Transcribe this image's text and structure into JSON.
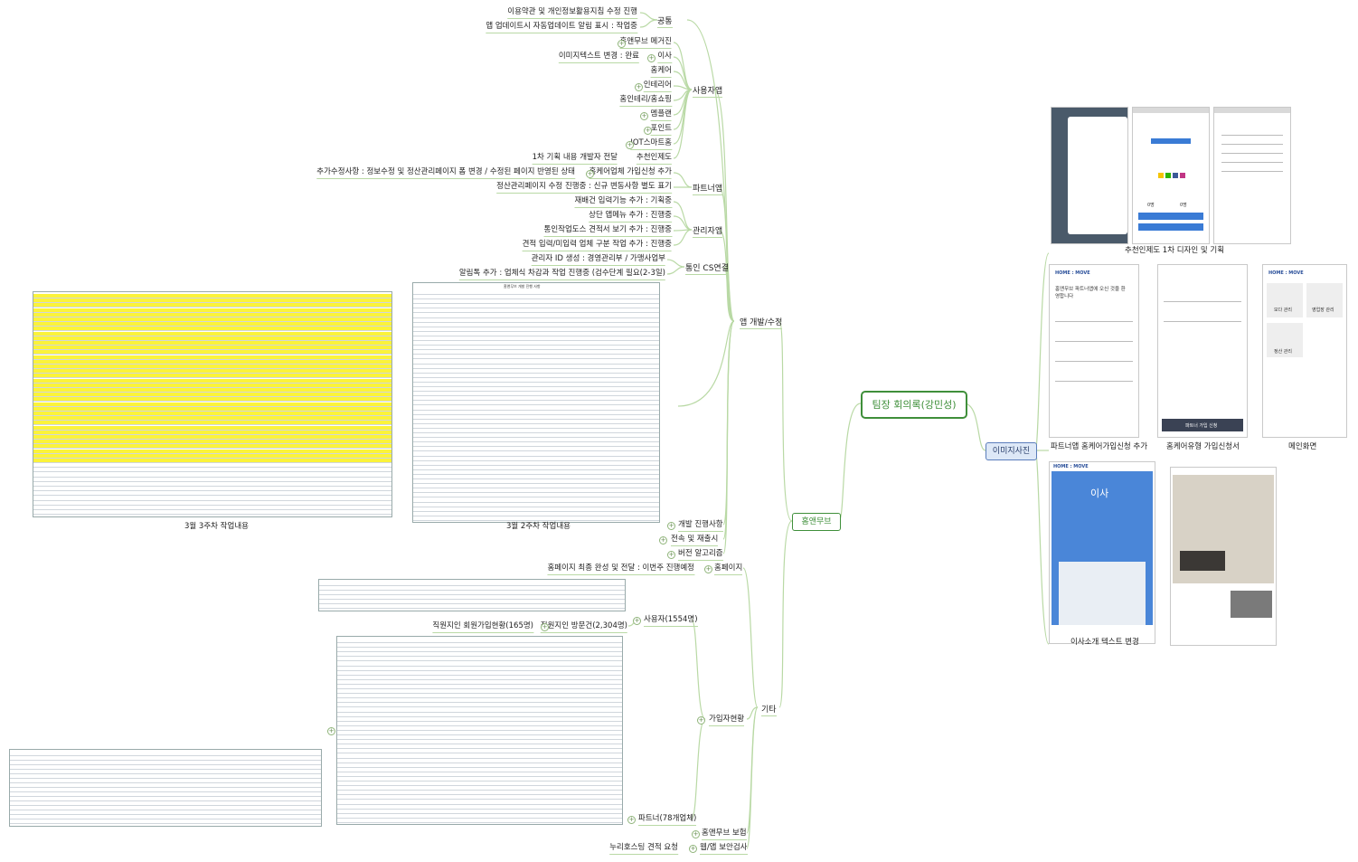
{
  "central": "팀장 회의록(강민성)",
  "left_root": "홈앤무브",
  "right_root": "이미지사진",
  "app_dev": {
    "label": "앱 개발/수정",
    "common": {
      "label": "공통",
      "items": [
        "이용약관 및 개인정보활용지침 수정 진행",
        "앱 업데이트시 자동업데이트 알림 표시 : 작업중"
      ]
    },
    "user_app": {
      "label": "사용자앱",
      "items": [
        "홈앤무브 메거진",
        "이사",
        "이미지텍스트 변경 : 완료",
        "홈케어",
        "인테리어",
        "홈인테리/홈쇼핑",
        "멤플랜",
        "포인트",
        "IOT스마트홈",
        "추천인제도"
      ],
      "recommend_note": "1차 기획 내용 개발자 전달"
    },
    "partner_app": {
      "label": "파트너앱",
      "join": "홈케어업체 가입신청 추가",
      "join_note": "추가수정사항 : 정보수정 및 정산관리페이지 폼 변경 / 수정된 페이지 반영된 상태",
      "settle": "정산관리페이지 수정 진행중 : 신규 변동사항 별도 표기"
    },
    "admin_app": {
      "label": "관리자앱",
      "items": [
        "재배건 입력기능 추가 : 기획중",
        "상단 앱메뉴 추가 : 진행중",
        "통인작업도스 견적서 보기 추가 : 진행중",
        "견적 입력/미입력 업체 구분 작업 추가 : 진행중"
      ]
    },
    "cs": {
      "label": "통인 CS연결",
      "items": [
        "관리자 ID 생성 : 경영관리부 / 가맹사업부",
        "알림톡 추가 : 업체식 차감과 작업 진행중 (검수단계 필요(2-3일)"
      ]
    },
    "sheet1_caption": "3월 3주차 작업내용",
    "sheet2_caption": "3월 2주차 작업내용",
    "sheet2_title": "홈앤무브 개발 진행 사항",
    "dev_progress": "개발 진행사항",
    "release": "전속 및 재출시",
    "version_alarm": "버전 알고리즘"
  },
  "etc": {
    "label": "기타",
    "homepage": "홈페이지",
    "homepage_note": "홈페이지 최종 완성 및 전달 : 이번주 진행예정",
    "users": "사용자(1554명)",
    "staff_join": "직원지인 회원가입현황(165명)",
    "staff_visit": "직원지인 방문건(2,304명)",
    "join_status": "가입자현황",
    "partner": "파트너(78개업체)",
    "homemove_report": "홈앤무브 보험",
    "security": "웹/앱 보안검사",
    "nuri_hosting": "누리호스팅 견적 요청"
  },
  "images": {
    "recommend_caption": "추천인제도 1차 디자인 및 기획",
    "partner_join_caption": "파트너앱 홈케어가입신청 추가",
    "homecare_caption": "홈케어유형 가입신청서",
    "main_caption": "메인화면",
    "moving_caption": "이사소개 텍스트 변경",
    "phone": {
      "brand": "HOME : MOVE",
      "welcome": "홈앤무브 파트너앱에 오신 것을 환영합니다",
      "moving_big": "이사",
      "recommend_counts": [
        "0명",
        "0명"
      ],
      "apply_btn": "파트너 가입 신청",
      "menu": [
        "모다 관리",
        "영업장 관리",
        "정산 관리"
      ]
    }
  },
  "colors": {
    "accent_green": "#3f8f3a",
    "branch_line": "#b9d9a5",
    "image_node": "#dde8f7",
    "highlight": "#fbf33a"
  }
}
